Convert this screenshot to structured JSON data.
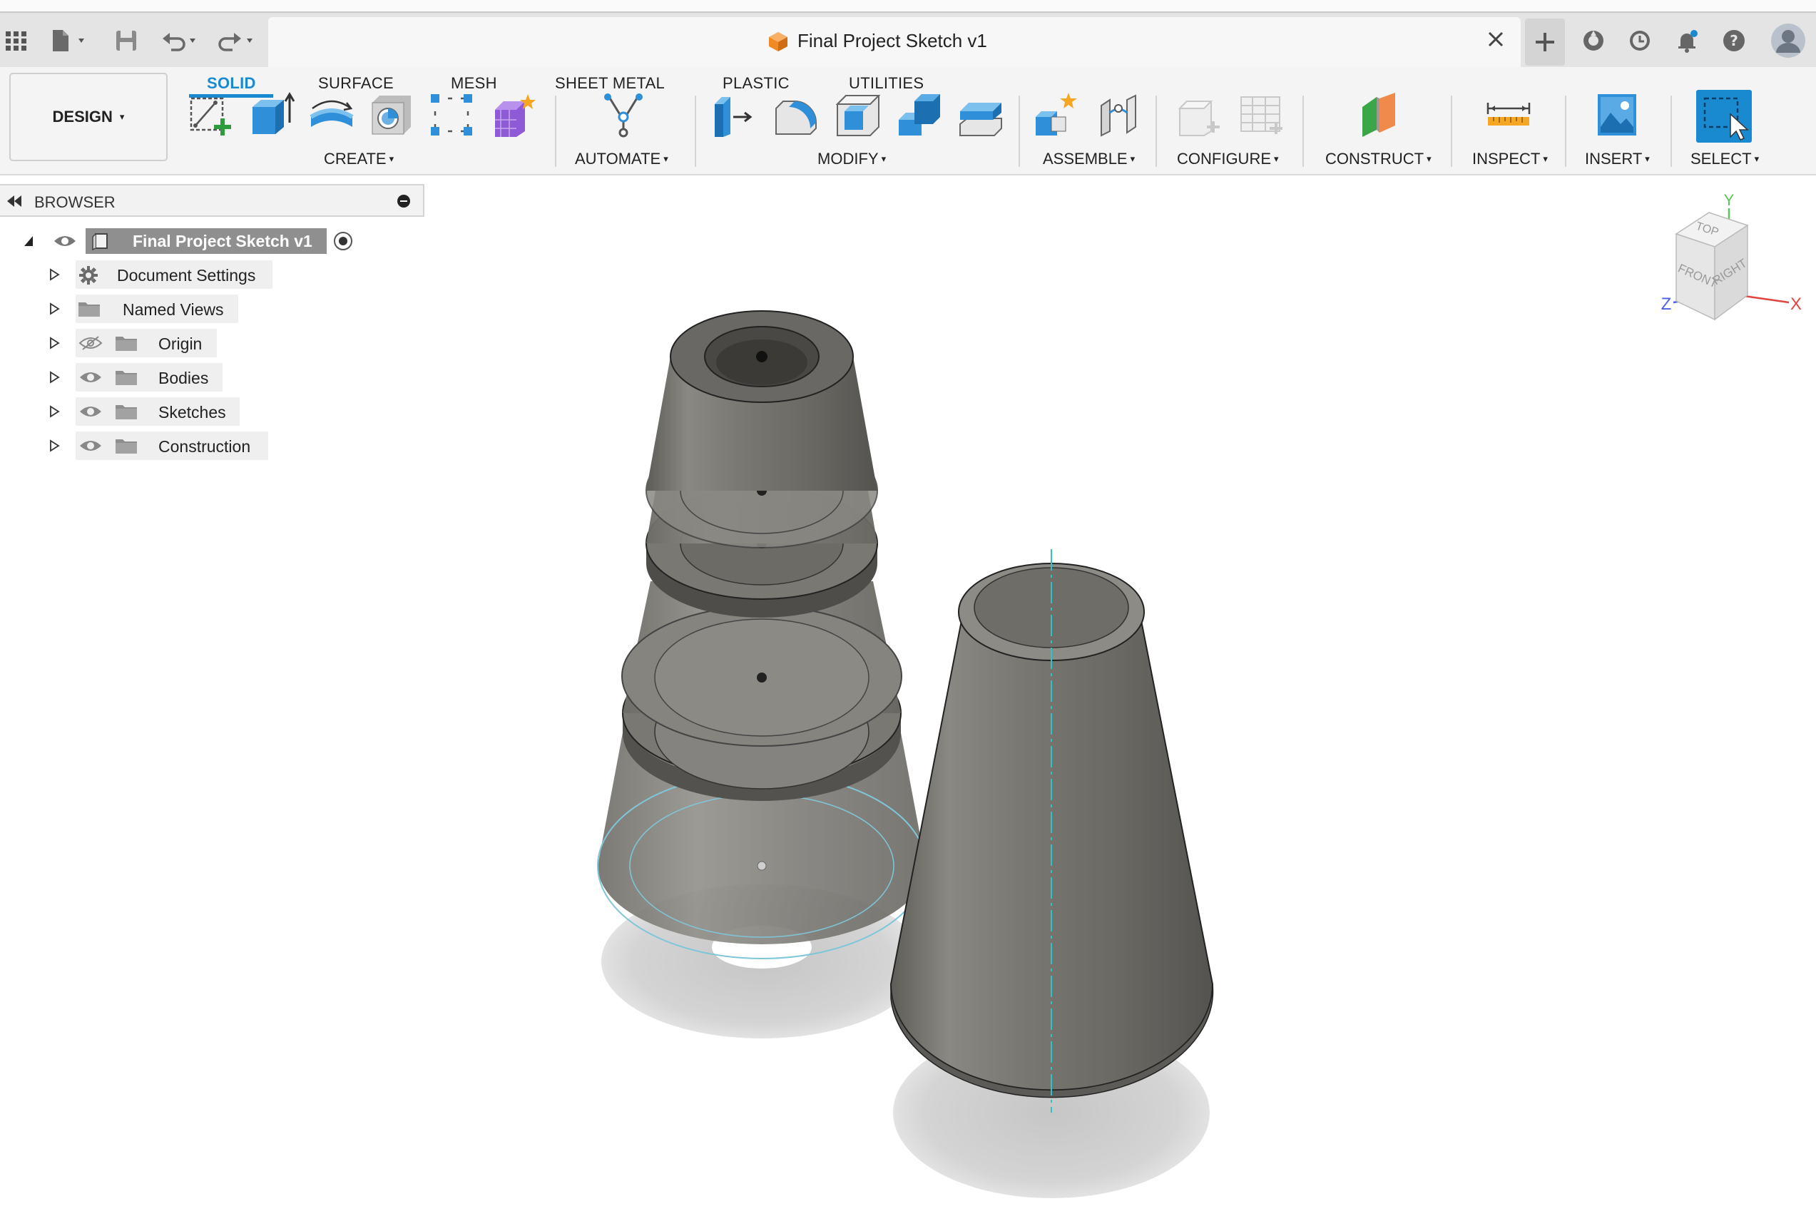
{
  "window": {
    "title": "Final Project Sketch v1"
  },
  "workspace": {
    "label": "DESIGN"
  },
  "ribbon": {
    "tabs": [
      {
        "label": "SOLID",
        "active": true
      },
      {
        "label": "SURFACE",
        "active": false
      },
      {
        "label": "MESH",
        "active": false
      },
      {
        "label": "SHEET METAL",
        "active": false
      },
      {
        "label": "PLASTIC",
        "active": false
      },
      {
        "label": "UTILITIES",
        "active": false
      }
    ],
    "groups": {
      "create": "CREATE",
      "automate": "AUTOMATE",
      "modify": "MODIFY",
      "assemble": "ASSEMBLE",
      "configure": "CONFIGURE",
      "construct": "CONSTRUCT",
      "inspect": "INSPECT",
      "insert": "INSERT",
      "select": "SELECT"
    },
    "caret": "▾"
  },
  "browser": {
    "title": "BROWSER",
    "root": "Final Project Sketch v1",
    "items": [
      {
        "label": "Document Settings",
        "icon": "gear-icon"
      },
      {
        "label": "Named Views",
        "icon": "folder-icon"
      },
      {
        "label": "Origin",
        "icon": "folder-icon",
        "visibility": "hidden"
      },
      {
        "label": "Bodies",
        "icon": "folder-icon",
        "visibility": "visible"
      },
      {
        "label": "Sketches",
        "icon": "folder-icon",
        "visibility": "visible"
      },
      {
        "label": "Construction",
        "icon": "folder-icon",
        "visibility": "visible"
      }
    ]
  },
  "view_cube": {
    "faces": {
      "top": "TOP",
      "front": "FRONT",
      "right": "RIGHT"
    },
    "axes": {
      "x": "X",
      "y": "Y",
      "z": "Z"
    }
  },
  "colors": {
    "accent": "#1a8ad0",
    "body": "#7a7872",
    "shadow": "#d2d2d2",
    "axis_x": "#e0453f",
    "axis_y": "#5cc45c",
    "axis_z": "#4d5fe8",
    "sketch_line": "#7fc6d8"
  }
}
